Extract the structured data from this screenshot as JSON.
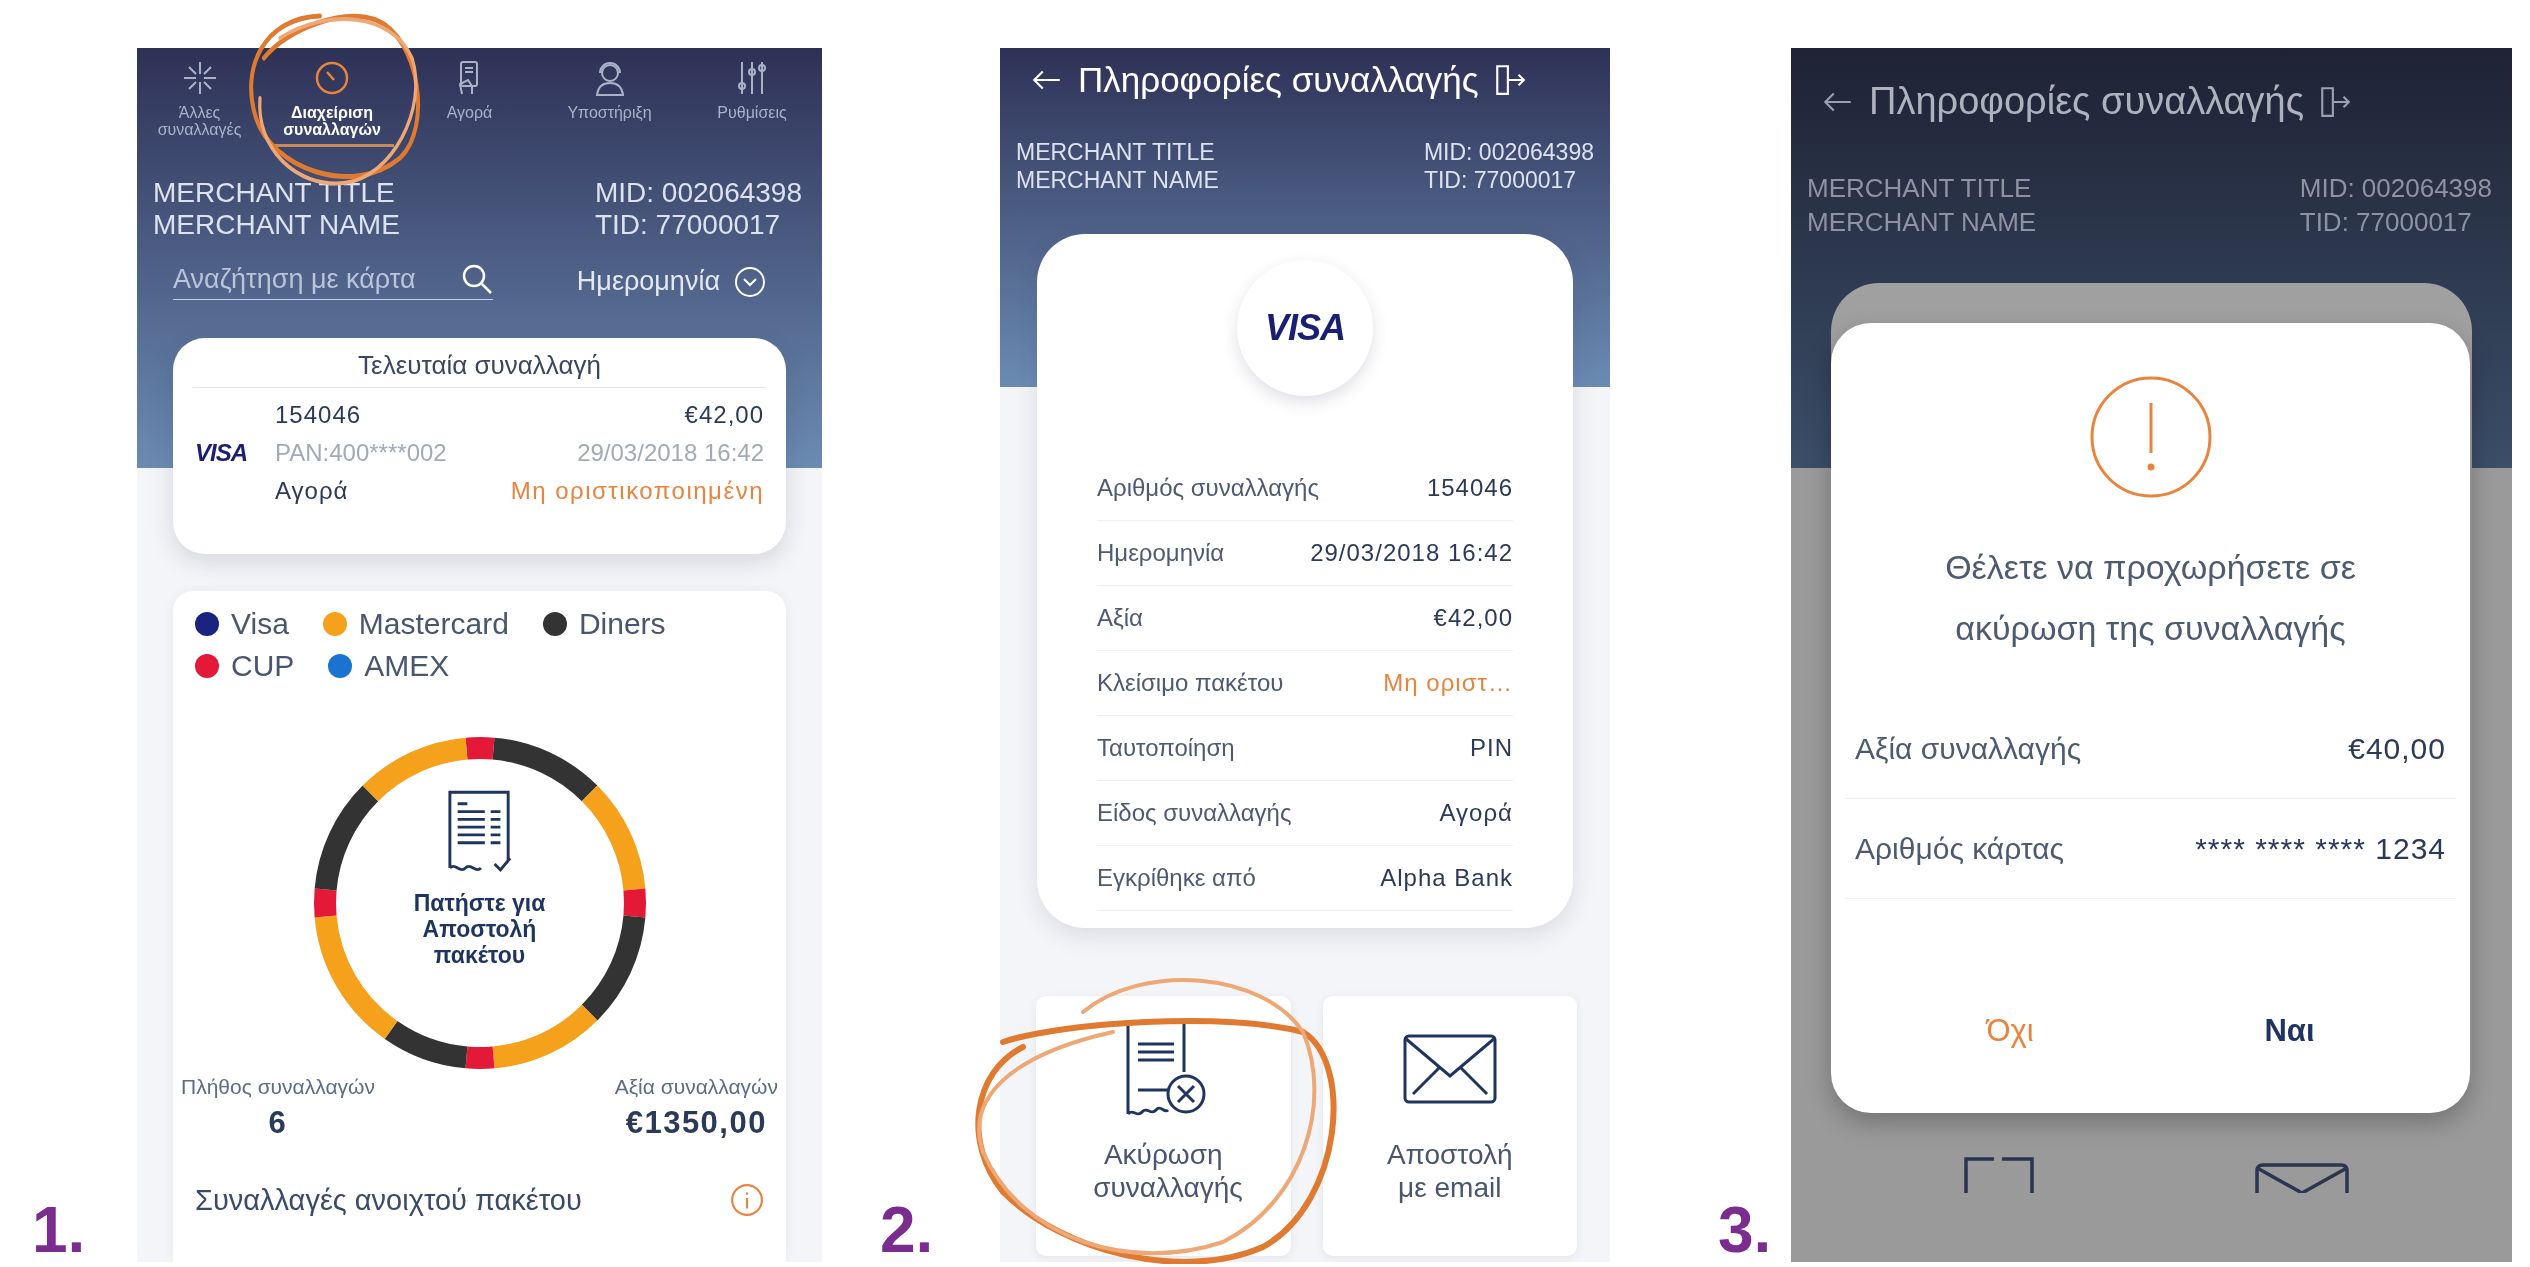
{
  "screen_1": {
    "step_label": "1.",
    "tabs": [
      {
        "label": "Άλλες συναλλαγές",
        "selected": false
      },
      {
        "label": "Διαχείριση συναλλαγών",
        "selected": true
      },
      {
        "label": "Αγορά",
        "selected": false
      },
      {
        "label": "Υποστήριξη",
        "selected": false
      },
      {
        "label": "Ρυθμίσεις",
        "selected": false
      }
    ],
    "merchant": {
      "title": "MERCHANT TITLE",
      "name": "MERCHANT NAME",
      "mid": "MID: 002064398",
      "tid": "TID: 77000017"
    },
    "search": {
      "placeholder": "Αναζήτηση με κάρτα"
    },
    "date_filter": {
      "label": "Ημερομηνία"
    },
    "last_transaction": {
      "title": "Τελευταία συναλλαγή",
      "card_brand": "VISA",
      "number": "154046",
      "amount": "€42,00",
      "pan": "PAN:400****002",
      "datetime": "29/03/2018 16:42",
      "type": "Αγορά",
      "status": "Μη οριστικοποιημένη"
    },
    "legend": [
      {
        "label": "Visa",
        "color": "#1a237e"
      },
      {
        "label": "Mastercard",
        "color": "#f5a11c"
      },
      {
        "label": "Diners",
        "color": "#333333"
      },
      {
        "label": "CUP",
        "color": "#e31937"
      },
      {
        "label": "AMEX",
        "color": "#1a73d1"
      }
    ],
    "send_batch": {
      "label": "Πατήστε για Αποστολή πακέτου"
    },
    "stats": [
      {
        "label": "Πλήθος συναλλαγών",
        "value": "6"
      },
      {
        "label": "Αξία συναλλαγών",
        "value": "€1350,00"
      }
    ],
    "open_batch": {
      "label": "Συναλλαγές ανοιχτού πακέτου"
    }
  },
  "screen_2": {
    "step_label": "2.",
    "title": "Πληροφορίες συναλλαγής",
    "merchant": {
      "title": "MERCHANT TITLE",
      "name": "MERCHANT NAME",
      "mid": "MID: 002064398",
      "tid": "TID: 77000017"
    },
    "card_brand": "VISA",
    "details": [
      {
        "label": "Αριθμός συναλλαγής",
        "value": "154046",
        "highlighted": false
      },
      {
        "label": "Ημερομηνία",
        "value": "29/03/2018 16:42",
        "highlighted": false
      },
      {
        "label": "Αξία",
        "value": "€42,00",
        "highlighted": false
      },
      {
        "label": "Κλείσιμο πακέτου",
        "value": "Μη οριστ…",
        "highlighted": true
      },
      {
        "label": "Ταυτοποίηση",
        "value": "PIN",
        "highlighted": false
      },
      {
        "label": "Είδος συναλλαγής",
        "value": "Αγορά",
        "highlighted": false
      },
      {
        "label": "Εγκρίθηκε από",
        "value": "Alpha Bank",
        "highlighted": false
      }
    ],
    "actions": [
      {
        "label": "Ακύρωση συναλλαγής"
      },
      {
        "label": "Αποστολή με email"
      }
    ]
  },
  "screen_3": {
    "step_label": "3.",
    "title": "Πληροφορίες συναλλαγής",
    "merchant": {
      "title": "MERCHANT TITLE",
      "name": "MERCHANT NAME",
      "mid": "MID: 002064398",
      "tid": "TID: 77000017"
    },
    "dialog": {
      "message": "Θέλετε να προχωρήσετε σε ακύρωση της συναλλαγής",
      "rows": [
        {
          "label": "Αξία συναλλαγής",
          "value": "€40,00"
        },
        {
          "label": "Αριθμός κάρτας",
          "value": "**** **** **** 1234"
        }
      ],
      "buttons": [
        {
          "label": "Όχι",
          "kind": "cancel"
        },
        {
          "label": "Ναι",
          "kind": "confirm"
        }
      ]
    }
  }
}
